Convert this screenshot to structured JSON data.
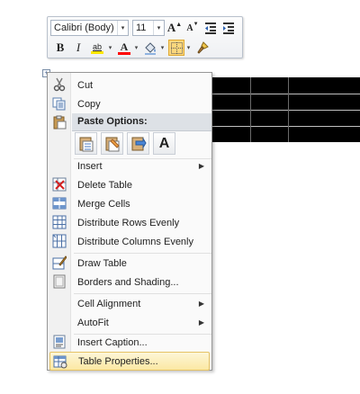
{
  "toolbar": {
    "font_name": "Calibri (Body)",
    "font_size": "11",
    "grow_font_glyph": "A",
    "shrink_font_glyph": "A",
    "bold_glyph": "B",
    "italic_glyph": "I",
    "highlight_glyph": "ab",
    "font_color_glyph": "A",
    "dropdown_glyph": "▾"
  },
  "menu": {
    "table_handle_glyph": "+",
    "items": [
      {
        "label": "Cut",
        "icon": "scissors-icon"
      },
      {
        "label": "Copy",
        "icon": "copy-icon"
      },
      {
        "label": "Paste Options:",
        "icon": "clipboard-icon"
      },
      {
        "label": "Insert",
        "icon": "",
        "submenu": true
      },
      {
        "label": "Delete Table",
        "icon": "delete-table-icon"
      },
      {
        "label": "Merge Cells",
        "icon": "merge-cells-icon"
      },
      {
        "label": "Distribute Rows Evenly",
        "icon": "distribute-rows-icon"
      },
      {
        "label": "Distribute Columns Evenly",
        "icon": "distribute-columns-icon"
      },
      {
        "label": "Draw Table",
        "icon": "draw-table-icon"
      },
      {
        "label": "Borders and Shading...",
        "icon": "borders-shading-icon"
      },
      {
        "label": "Cell Alignment",
        "icon": "",
        "submenu": true
      },
      {
        "label": "AutoFit",
        "icon": "",
        "submenu": true
      },
      {
        "label": "Insert Caption...",
        "icon": "insert-caption-icon"
      },
      {
        "label": "Table Properties...",
        "icon": "table-properties-icon",
        "highlighted": true
      }
    ],
    "paste_options": [
      {
        "icon": "keep-source-formatting-icon"
      },
      {
        "icon": "merge-formatting-icon"
      },
      {
        "icon": "nest-table-icon"
      },
      {
        "icon": "keep-text-only-icon",
        "glyph": "A"
      }
    ],
    "submenu_arrow": "▶"
  },
  "colors": {
    "highlight_bar": "#ffe600",
    "font_color_bar": "#ff0000",
    "hover_fill": "#fbe8a3",
    "hover_border": "#e5c365"
  }
}
